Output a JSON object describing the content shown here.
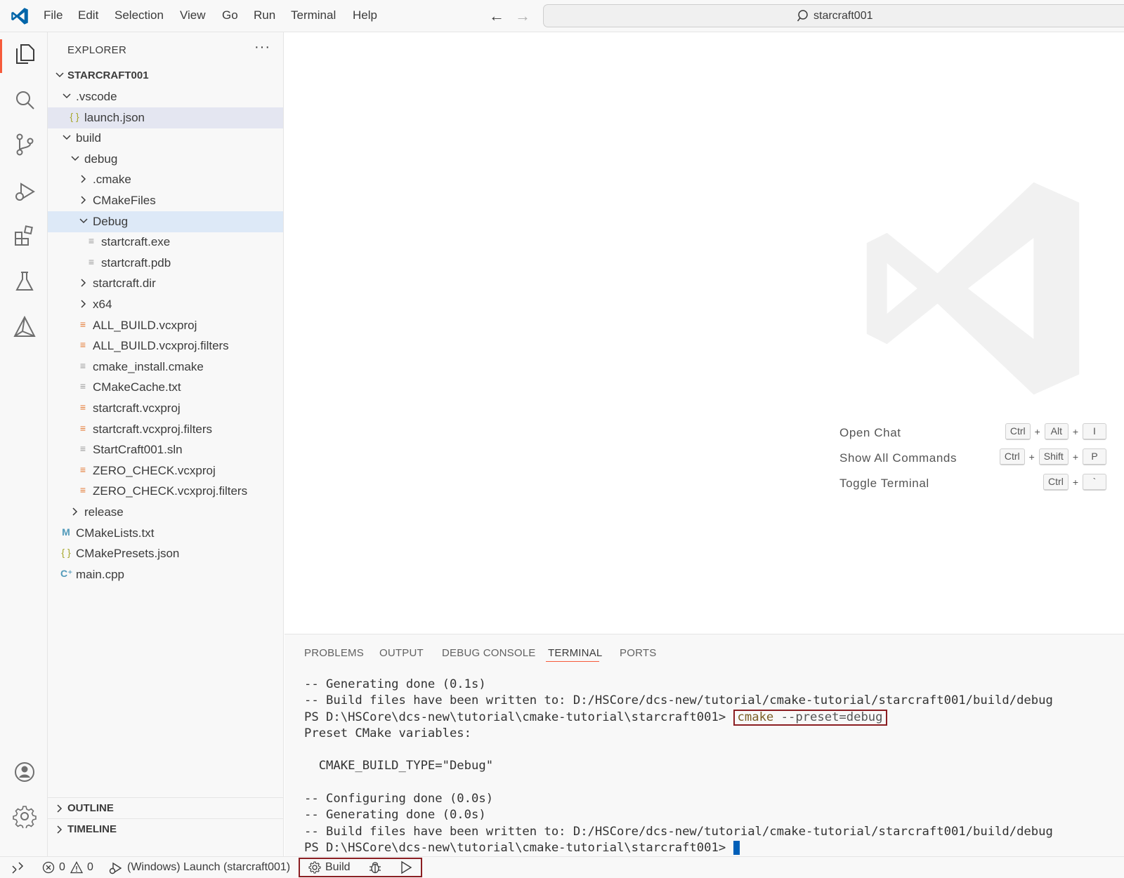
{
  "titlebar": {
    "menus": [
      "File",
      "Edit",
      "Selection",
      "View",
      "Go",
      "Run",
      "Terminal",
      "Help"
    ],
    "search_text": "starcraft001",
    "back_icon": "arrow-left-icon",
    "forward_icon": "arrow-right-icon"
  },
  "activitybar": {
    "items": [
      "explorer-icon",
      "search-icon",
      "source-control-icon",
      "run-debug-icon",
      "extensions-icon",
      "testing-icon",
      "cmake-icon"
    ],
    "bottom_items": [
      "account-icon",
      "settings-gear-icon"
    ]
  },
  "sidebar": {
    "title": "EXPLORER",
    "more": "···",
    "root": "STARCRAFT001",
    "tree": [
      {
        "label": ".vscode",
        "type": "folder",
        "open": true
      },
      {
        "label": "launch.json",
        "type": "json"
      },
      {
        "label": "build",
        "type": "folder",
        "open": true
      },
      {
        "label": "debug",
        "type": "folder",
        "open": true
      },
      {
        "label": ".cmake",
        "type": "folder",
        "open": false
      },
      {
        "label": "CMakeFiles",
        "type": "folder",
        "open": false
      },
      {
        "label": "Debug",
        "type": "folder",
        "open": true
      },
      {
        "label": "startcraft.exe",
        "type": "text"
      },
      {
        "label": "startcraft.pdb",
        "type": "text"
      },
      {
        "label": "startcraft.dir",
        "type": "folder",
        "open": false
      },
      {
        "label": "x64",
        "type": "folder",
        "open": false
      },
      {
        "label": "ALL_BUILD.vcxproj",
        "type": "rss"
      },
      {
        "label": "ALL_BUILD.vcxproj.filters",
        "type": "rss"
      },
      {
        "label": "cmake_install.cmake",
        "type": "text"
      },
      {
        "label": "CMakeCache.txt",
        "type": "text"
      },
      {
        "label": "startcraft.vcxproj",
        "type": "rss"
      },
      {
        "label": "startcraft.vcxproj.filters",
        "type": "rss"
      },
      {
        "label": "StartCraft001.sln",
        "type": "text"
      },
      {
        "label": "ZERO_CHECK.vcxproj",
        "type": "rss"
      },
      {
        "label": "ZERO_CHECK.vcxproj.filters",
        "type": "rss"
      },
      {
        "label": "release",
        "type": "folder",
        "open": false
      },
      {
        "label": "CMakeLists.txt",
        "type": "cmake"
      },
      {
        "label": "CMakePresets.json",
        "type": "json"
      },
      {
        "label": "main.cpp",
        "type": "cpp"
      }
    ],
    "outline": "OUTLINE",
    "timeline": "TIMELINE"
  },
  "editor": {
    "shortcuts": [
      {
        "label": "Open Chat",
        "keys": [
          "Ctrl",
          "Alt",
          "I"
        ]
      },
      {
        "label": "Show All Commands",
        "keys": [
          "Ctrl",
          "Shift",
          "P"
        ]
      },
      {
        "label": "Toggle Terminal",
        "keys": [
          "Ctrl",
          "`"
        ]
      }
    ]
  },
  "panel": {
    "tabs": [
      "PROBLEMS",
      "OUTPUT",
      "DEBUG CONSOLE",
      "TERMINAL",
      "PORTS"
    ],
    "active_tab": "TERMINAL",
    "terminal": {
      "line1": "-- Generating done (0.1s)",
      "line2": "-- Build files have been written to: D:/HSCore/dcs-new/tutorial/cmake-tutorial/starcraft001/build/debug",
      "prompt": "PS D:\\HSCore\\dcs-new\\tutorial\\cmake-tutorial\\starcraft001> ",
      "cmd_word": "cmake",
      "cmd_arg": " --preset=debug",
      "line4": "Preset CMake variables:",
      "line5": "",
      "line6": "  CMAKE_BUILD_TYPE=\"Debug\"",
      "line7": "",
      "line8": "-- Configuring done (0.0s)",
      "line9": "-- Generating done (0.0s)",
      "line10": "-- Build files have been written to: D:/HSCore/dcs-new/tutorial/cmake-tutorial/starcraft001/build/debug",
      "prompt2": "PS D:\\HSCore\\dcs-new\\tutorial\\cmake-tutorial\\starcraft001> "
    }
  },
  "statusbar": {
    "errors": "0",
    "warnings": "0",
    "launch": "(Windows) Launch (starcraft001)",
    "build": "Build"
  },
  "colors": {
    "accent": "#f65b3b",
    "highlight_box": "#8b1e22",
    "vscode_blue": "#0065a9"
  }
}
